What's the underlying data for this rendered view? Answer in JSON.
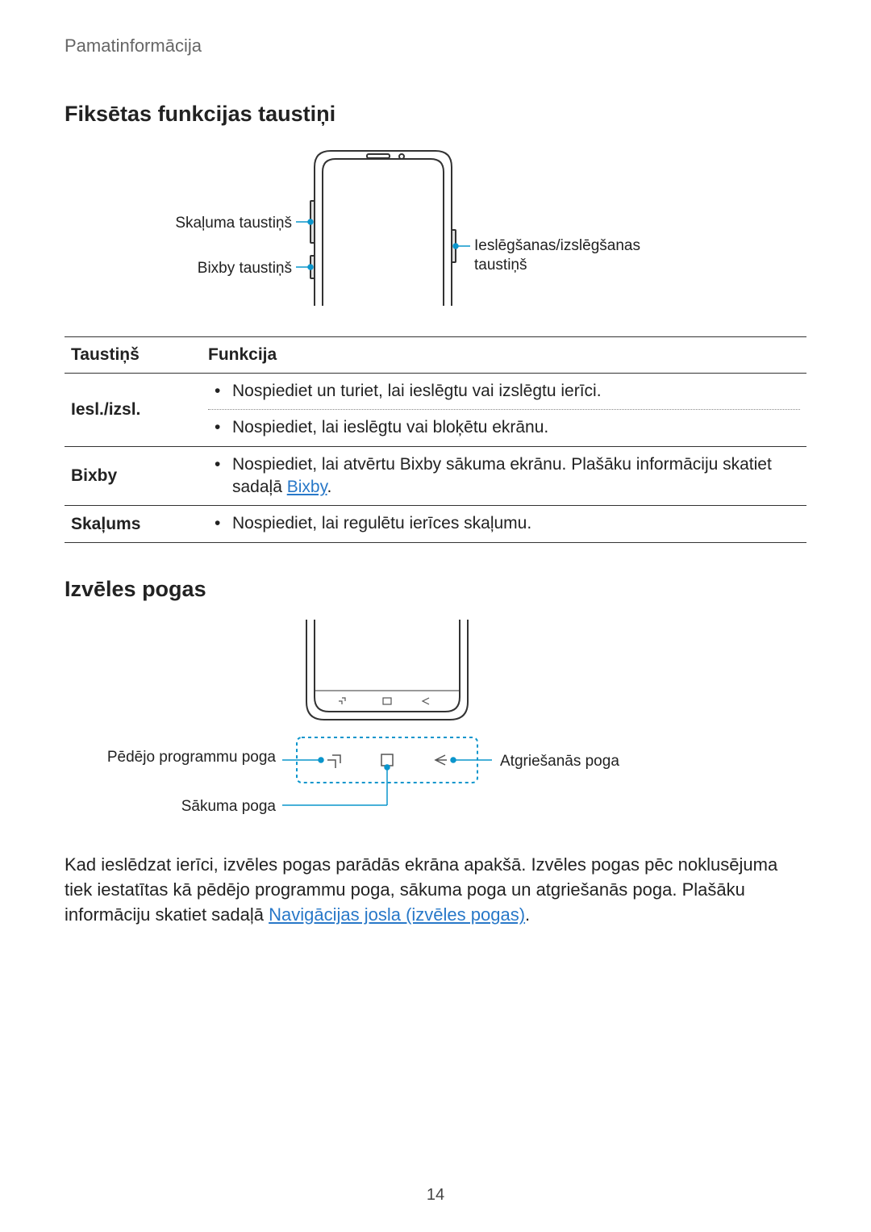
{
  "breadcrumb": "Pamatinformācija",
  "section1_title": "Fiksētas funkcijas taustiņi",
  "diagram1_labels": {
    "volume": "Skaļuma taustiņš",
    "bixby": "Bixby taustiņš",
    "power": "Ieslēgšanas/izslēgšanas taustiņš"
  },
  "table": {
    "head_key": "Taustiņš",
    "head_func": "Funkcija",
    "rows": [
      {
        "key": "Iesl./izsl.",
        "funcs": [
          "Nospiediet un turiet, lai ieslēgtu vai izslēgtu ierīci.",
          "Nospiediet, lai ieslēgtu vai bloķētu ekrānu."
        ]
      },
      {
        "key": "Bixby",
        "func_prefix": "Nospiediet, lai atvērtu Bixby sākuma ekrānu. Plašāku informāciju skatiet sadaļā ",
        "func_link": "Bixby",
        "func_suffix": "."
      },
      {
        "key": "Skaļums",
        "funcs": [
          "Nospiediet, lai regulētu ierīces skaļumu."
        ]
      }
    ]
  },
  "section2_title": "Izvēles pogas",
  "diagram2_labels": {
    "recents": "Pēdējo programmu poga",
    "home": "Sākuma poga",
    "back": "Atgriešanās poga"
  },
  "body_text_prefix": "Kad ieslēdzat ierīci, izvēles pogas parādās ekrāna apakšā. Izvēles pogas pēc noklusējuma tiek iestatītas kā pēdējo programmu poga, sākuma poga un atgriešanās poga. Plašāku informāciju skatiet sadaļā ",
  "body_text_link": "Navigācijas josla (izvēles pogas)",
  "body_text_suffix": ".",
  "page_number": "14"
}
